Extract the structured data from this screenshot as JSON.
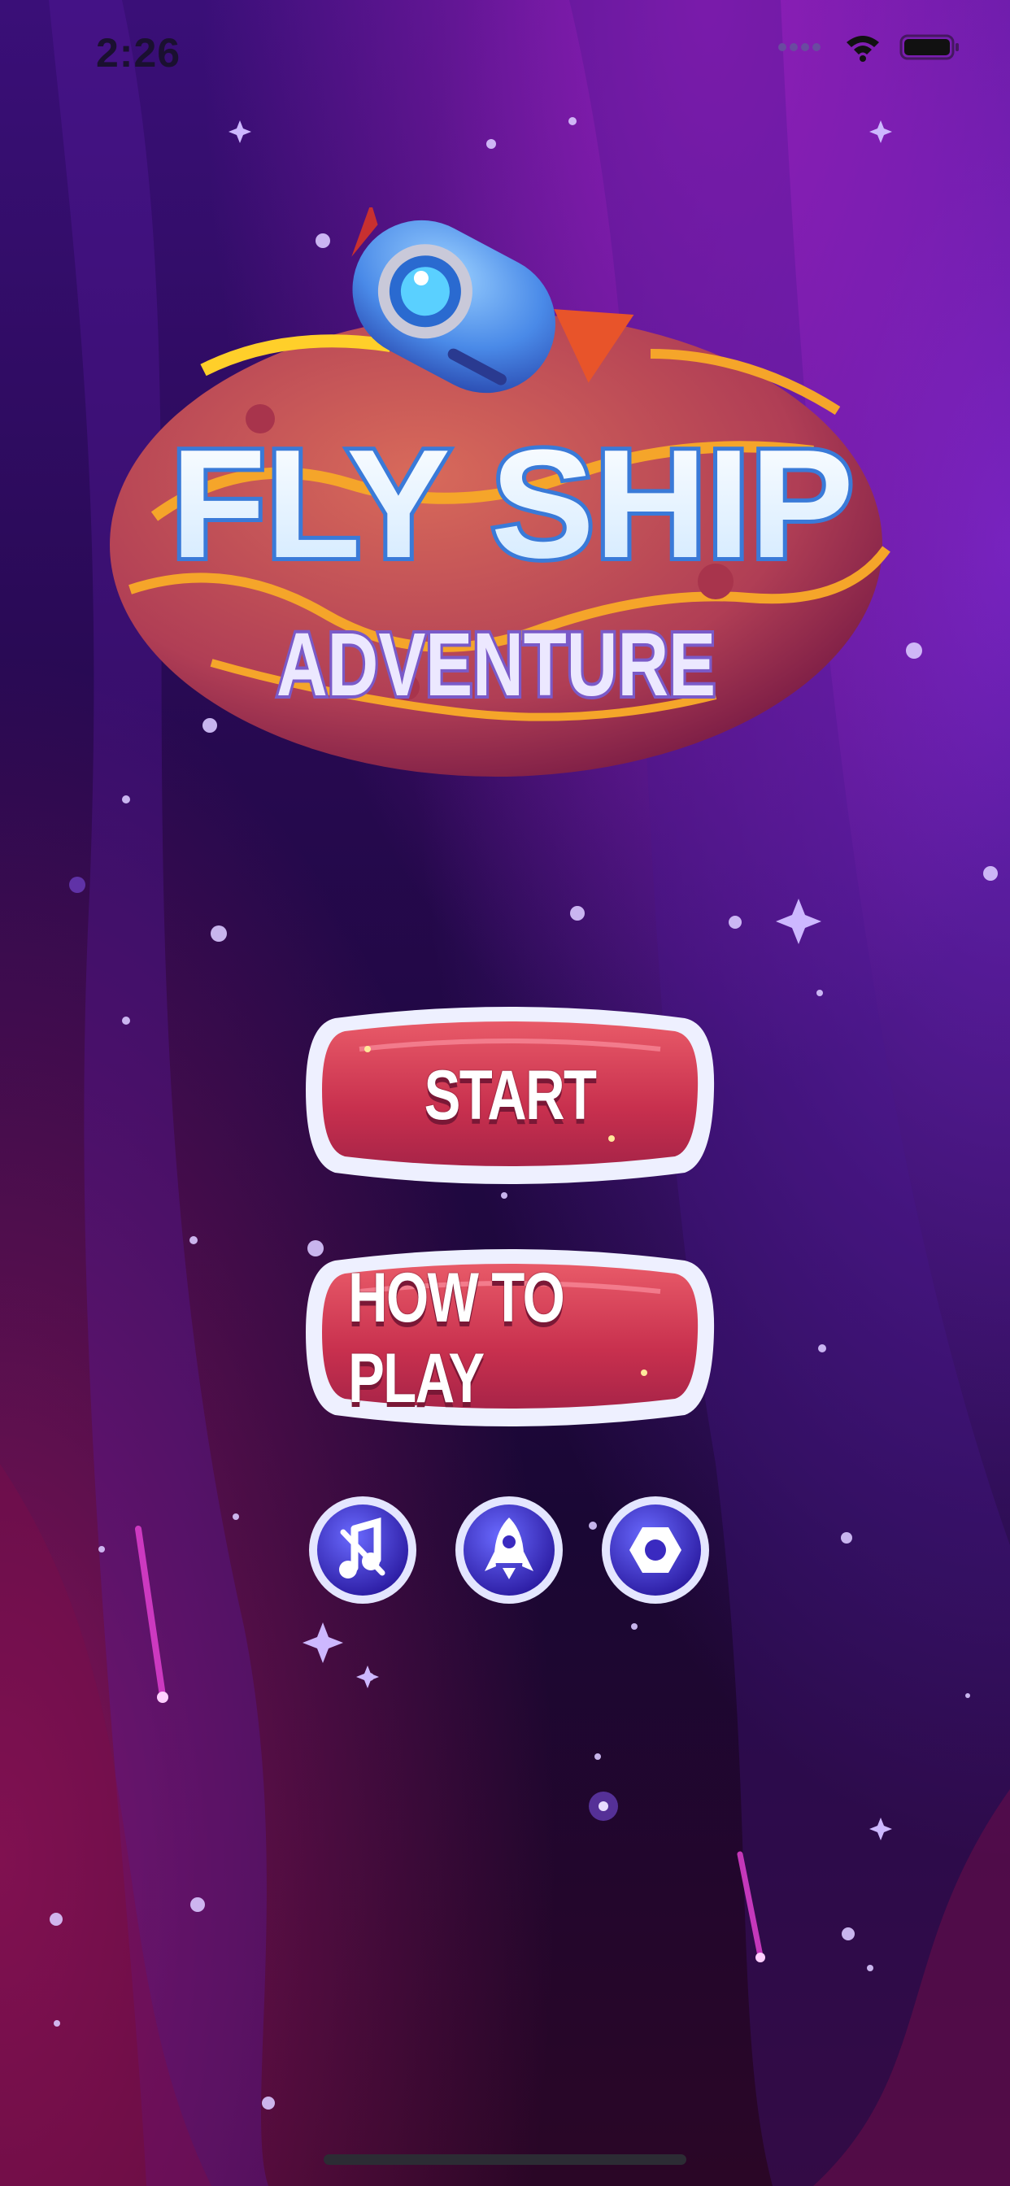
{
  "status_bar": {
    "time": "2:26"
  },
  "logo": {
    "title": "FLY SHIP",
    "subtitle": "ADVENTURE"
  },
  "menu": {
    "start_label": "START",
    "how_to_play_label": "HOW TO PLAY"
  },
  "icon_buttons": [
    {
      "icon": "music-note-icon"
    },
    {
      "icon": "rocket-icon"
    },
    {
      "icon": "settings-hexagon-icon"
    }
  ],
  "colors": {
    "bg_top": "#3a1070",
    "bg_bottom": "#1a0530",
    "button_red": "#d63a5a",
    "button_rim": "#dfe4ff",
    "orb_blue": "#4a3ad8"
  }
}
